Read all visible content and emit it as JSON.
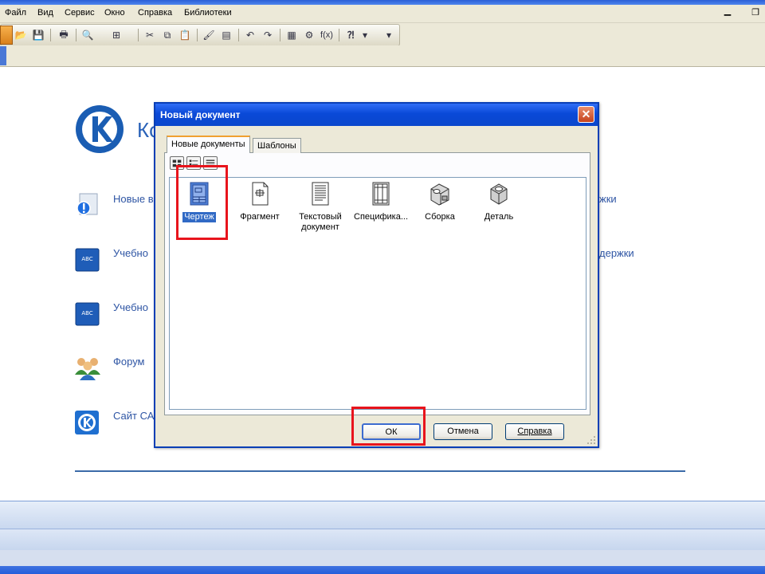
{
  "menu": {
    "items": [
      {
        "label": "Файл"
      },
      {
        "label": "Вид"
      },
      {
        "label": "Сервис"
      },
      {
        "label": "Окно"
      },
      {
        "label": "Справка"
      },
      {
        "label": "Библиотеки"
      }
    ]
  },
  "start_page": {
    "title_fragment": "Ко",
    "links": [
      {
        "left_text": "Новые в",
        "right_text": "жки",
        "icon": "info-book-icon"
      },
      {
        "left_text": "Учебно",
        "right_text": "держки",
        "icon": "abc-book-icon"
      },
      {
        "left_text": "Учебно",
        "icon": "abc-book-icon"
      },
      {
        "left_text": "Форум",
        "icon": "users-group-icon"
      },
      {
        "left_text": "Сайт СА",
        "icon": "kompas-logo-icon"
      }
    ]
  },
  "dialog": {
    "title": "Новый документ",
    "close_glyph": "✕",
    "tabs": [
      {
        "label": "Новые документы"
      },
      {
        "label": "Шаблоны"
      }
    ],
    "items": [
      {
        "label": "Чертеж",
        "icon": "drawing-sheet-icon"
      },
      {
        "label": "Фрагмент",
        "icon": "fragment-icon"
      },
      {
        "label": "Текстовый документ",
        "icon": "text-document-icon"
      },
      {
        "label": "Специфика...",
        "icon": "specification-icon"
      },
      {
        "label": "Сборка",
        "icon": "assembly-icon"
      },
      {
        "label": "Деталь",
        "icon": "part-icon"
      }
    ],
    "buttons": {
      "ok": "ОК",
      "cancel": "Отмена",
      "help": "Справка"
    }
  },
  "colors": {
    "highlight": "#e8141c",
    "selection": "#316ac5",
    "title_bar": "#0a49d8"
  }
}
